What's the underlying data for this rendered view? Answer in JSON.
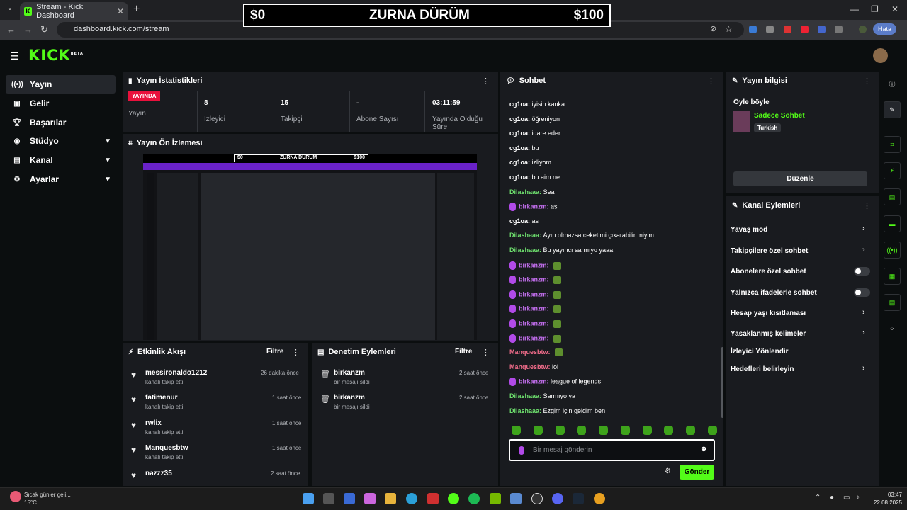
{
  "browser": {
    "tab_title": "Stream - Kick Dashboard",
    "url": "dashboard.kick.com/stream",
    "profile_badge": "Hata"
  },
  "overlay": {
    "left": "$0",
    "title": "ZURNA DÜRÜM",
    "right": "$100"
  },
  "logo": "KICK",
  "logo_beta": "BETA",
  "sidebar": {
    "items": [
      {
        "label": "Yayın",
        "icon": "broadcast-icon"
      },
      {
        "label": "Gelir",
        "icon": "money-icon"
      },
      {
        "label": "Başarılar",
        "icon": "trophy-icon"
      },
      {
        "label": "Stüdyo",
        "icon": "studio-icon"
      },
      {
        "label": "Kanal",
        "icon": "channel-icon"
      },
      {
        "label": "Ayarlar",
        "icon": "gear-icon"
      }
    ]
  },
  "stats": {
    "title": "Yayın İstatistikleri",
    "live_badge": "YAYINDA",
    "items": [
      {
        "value": "",
        "label": "Yayın"
      },
      {
        "value": "8",
        "label": "İzleyici"
      },
      {
        "value": "15",
        "label": "Takipçi"
      },
      {
        "value": "-",
        "label": "Abone Sayısı"
      },
      {
        "value": "03:11:59",
        "label": "Yayında Olduğu Süre"
      }
    ]
  },
  "preview": {
    "title": "Yayın Ön İzlemesi",
    "mini_left": "$0",
    "mini_title": "ZURNA DÜRÜM",
    "mini_right": "$100"
  },
  "activity": {
    "title": "Etkinlik Akışı",
    "filter": "Filtre",
    "items": [
      {
        "name": "messironaldo1212",
        "action": "kanalı takip etti",
        "time": "26 dakika önce"
      },
      {
        "name": "fatimenur",
        "action": "kanalı takip etti",
        "time": "1 saat önce"
      },
      {
        "name": "rwlix",
        "action": "kanalı takip etti",
        "time": "1 saat önce"
      },
      {
        "name": "Manquesbtw",
        "action": "kanalı takip etti",
        "time": "1 saat önce"
      },
      {
        "name": "nazzz35",
        "action": "",
        "time": "2 saat önce"
      }
    ]
  },
  "moderation": {
    "title": "Denetim Eylemleri",
    "filter": "Filtre",
    "items": [
      {
        "name": "birkanzm",
        "action": "bir mesajı sildi",
        "time": "2 saat önce"
      },
      {
        "name": "birkanzm",
        "action": "bir mesajı sildi",
        "time": "2 saat önce"
      }
    ]
  },
  "chat": {
    "title": "Sohbet",
    "messages": [
      {
        "user": "cg1oa",
        "color": "#ffffff",
        "text": "iyisin kanka",
        "mic": false,
        "emote": false
      },
      {
        "user": "cg1oa",
        "color": "#ffffff",
        "text": "öğreniyon",
        "mic": false,
        "emote": false
      },
      {
        "user": "cg1oa",
        "color": "#ffffff",
        "text": "idare eder",
        "mic": false,
        "emote": false
      },
      {
        "user": "cg1oa",
        "color": "#ffffff",
        "text": "bu",
        "mic": false,
        "emote": false
      },
      {
        "user": "cg1oa",
        "color": "#ffffff",
        "text": "izliyom",
        "mic": false,
        "emote": false
      },
      {
        "user": "cg1oa",
        "color": "#ffffff",
        "text": "bu aim ne",
        "mic": false,
        "emote": false
      },
      {
        "user": "Dilashaaa",
        "color": "#6ee06e",
        "text": "Sea",
        "mic": false,
        "emote": false
      },
      {
        "user": "birkanzm",
        "color": "#c670f2",
        "text": "as",
        "mic": true,
        "emote": false
      },
      {
        "user": "cg1oa",
        "color": "#ffffff",
        "text": "as",
        "mic": false,
        "emote": false
      },
      {
        "user": "Dilashaaa",
        "color": "#6ee06e",
        "text": "Ayıp olmazsa ceketimi çıkarabilir miyim",
        "mic": false,
        "emote": false
      },
      {
        "user": "Dilashaaa",
        "color": "#6ee06e",
        "text": "Bu yayıncı sarmıyo yaaa",
        "mic": false,
        "emote": false
      },
      {
        "user": "birkanzm",
        "color": "#c670f2",
        "text": "",
        "mic": true,
        "emote": true
      },
      {
        "user": "birkanzm",
        "color": "#c670f2",
        "text": "",
        "mic": true,
        "emote": true
      },
      {
        "user": "birkanzm",
        "color": "#c670f2",
        "text": "",
        "mic": true,
        "emote": true
      },
      {
        "user": "birkanzm",
        "color": "#c670f2",
        "text": "",
        "mic": true,
        "emote": true
      },
      {
        "user": "birkanzm",
        "color": "#c670f2",
        "text": "",
        "mic": true,
        "emote": true
      },
      {
        "user": "birkanzm",
        "color": "#c670f2",
        "text": "",
        "mic": true,
        "emote": true
      },
      {
        "user": "Manquesbtw",
        "color": "#f06c8a",
        "text": "",
        "mic": false,
        "emote": true
      },
      {
        "user": "Manquesbtw",
        "color": "#f06c8a",
        "text": "lol",
        "mic": false,
        "emote": false
      },
      {
        "user": "birkanzm",
        "color": "#c670f2",
        "text": "league of legends",
        "mic": true,
        "emote": false
      },
      {
        "user": "Dilashaaa",
        "color": "#6ee06e",
        "text": "Sarmıyo ya",
        "mic": false,
        "emote": false
      },
      {
        "user": "Dilashaaa",
        "color": "#6ee06e",
        "text": "Ezgim için geldim ben",
        "mic": false,
        "emote": false
      }
    ],
    "input_placeholder": "Bir mesaj gönderin",
    "send_label": "Gönder"
  },
  "stream_info": {
    "title": "Yayın bilgisi",
    "stream_title": "Öyle böyle",
    "category": "Sadece Sohbet",
    "language": "Turkish",
    "edit_label": "Düzenle"
  },
  "channel_actions": {
    "title": "Kanal Eylemleri",
    "items": [
      {
        "label": "Yavaş mod",
        "control": "chevron"
      },
      {
        "label": "Takipçilere özel sohbet",
        "control": "chevron"
      },
      {
        "label": "Abonelere özel sohbet",
        "control": "toggle"
      },
      {
        "label": "Yalnızca ifadelerle sohbet",
        "control": "toggle"
      },
      {
        "label": "Hesap yaşı kısıtlaması",
        "control": "chevron"
      },
      {
        "label": "Yasaklanmış kelimeler",
        "control": "chevron"
      },
      {
        "label": "İzleyici Yönlendir",
        "control": "none"
      },
      {
        "label": "Hedefleri belirleyin",
        "control": "chevron"
      }
    ]
  },
  "taskbar": {
    "weather_text": "Sıcak günler geli...",
    "temperature": "15°C",
    "time": "03:47",
    "date": "22.08.2025"
  },
  "colors": {
    "brand": "#53fc18",
    "live": "#e9113c",
    "panel": "#191b1f"
  }
}
